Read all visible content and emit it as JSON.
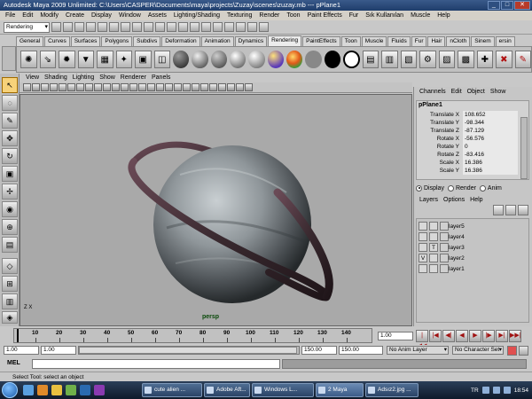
{
  "window": {
    "title": "Autodesk Maya 2009 Unlimited: C:\\Users\\CASPER\\Documents\\maya\\projects\\Zuzay\\scenes\\zuzay.mb --- pPlane1",
    "minimize": "_",
    "maximize": "□",
    "close": "✕"
  },
  "menubar": [
    "File",
    "Edit",
    "Modify",
    "Create",
    "Display",
    "Window",
    "Assets",
    "Lighting/Shading",
    "Texturing",
    "Render",
    "Toon",
    "Paint Effects",
    "Fur",
    "Sık Kullanılan",
    "Muscle",
    "Help"
  ],
  "statusline": {
    "mode": "Rendering"
  },
  "shelf_tabs": [
    "General",
    "Curves",
    "Surfaces",
    "Polygons",
    "Subdivs",
    "Deformation",
    "Animation",
    "Dynamics",
    "Rendering",
    "PaintEffects",
    "Toon",
    "Muscle",
    "Fluids",
    "Fur",
    "Hair",
    "nCloth",
    "Sinem",
    "ersin"
  ],
  "active_shelf_tab": "Rendering",
  "panel_menu": [
    "View",
    "Shading",
    "Lighting",
    "Show",
    "Renderer",
    "Panels"
  ],
  "viewport": {
    "camera": "persp",
    "axis": "Z X"
  },
  "channel_box": {
    "menu": [
      "Channels",
      "Edit",
      "Object",
      "Show"
    ],
    "object": "pPlane1",
    "channels": [
      {
        "attr": "Translate X",
        "value": "108.652"
      },
      {
        "attr": "Translate Y",
        "value": "-98.344"
      },
      {
        "attr": "Translate Z",
        "value": "-87.129"
      },
      {
        "attr": "Rotate X",
        "value": "-56.576"
      },
      {
        "attr": "Rotate Y",
        "value": "0"
      },
      {
        "attr": "Rotate Z",
        "value": "-83.416"
      },
      {
        "attr": "Scale X",
        "value": "16.386"
      },
      {
        "attr": "Scale Y",
        "value": "16.386"
      }
    ]
  },
  "layer_editor": {
    "modes": [
      "Display",
      "Render",
      "Anim"
    ],
    "selected_mode": "Display",
    "menu": [
      "Layers",
      "Options",
      "Help"
    ],
    "layers": [
      {
        "name": "layer5",
        "v": "",
        "t": ""
      },
      {
        "name": "layer4",
        "v": "",
        "t": ""
      },
      {
        "name": "layer3",
        "v": "",
        "t": "T"
      },
      {
        "name": "layer2",
        "v": "V",
        "t": ""
      },
      {
        "name": "layer1",
        "v": "",
        "t": ""
      }
    ]
  },
  "time_slider": {
    "ticks": [
      "10",
      "20",
      "30",
      "40",
      "50",
      "60",
      "70",
      "80",
      "90",
      "100",
      "110",
      "120",
      "130",
      "140"
    ],
    "current_frame": "1.00",
    "playback_buttons": [
      "|◀◀",
      "|◀",
      "◀|",
      "◀",
      "▶",
      "|▶",
      "▶|",
      "▶▶|"
    ]
  },
  "range_slider": {
    "start": "1.00",
    "start2": "1.00",
    "end": "150.00",
    "end2": "150.00",
    "anim_layer": "No Anim Layer",
    "character_set": "No Character Set"
  },
  "command_line": {
    "label": "MEL"
  },
  "help_line": "Select Tool: select an object",
  "taskbar": {
    "tasks": [
      {
        "label": "cute alien ..."
      },
      {
        "label": "Adobe Aft..."
      },
      {
        "label": "Windows L..."
      },
      {
        "label": "2 Maya"
      },
      {
        "label": "Adsız2.jpg ..."
      }
    ],
    "language": "TR",
    "clock": "18:54"
  },
  "colors": {
    "title_bar": "#1f3d6b",
    "viewport_bg": "#a9a9a9",
    "camera_label": "#0a4a0a"
  }
}
